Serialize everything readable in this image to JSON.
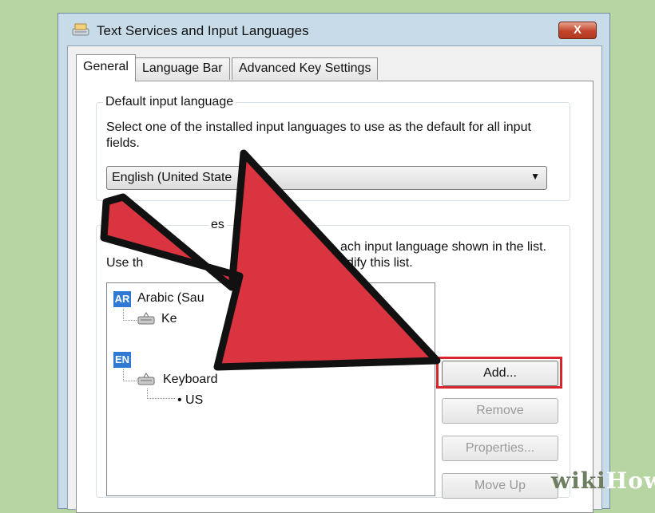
{
  "window": {
    "title": "Text Services and Input Languages",
    "close_label": "X"
  },
  "tabs": [
    {
      "label": "General",
      "active": true
    },
    {
      "label": "Language Bar",
      "active": false
    },
    {
      "label": "Advanced Key Settings",
      "active": false
    }
  ],
  "default_input": {
    "legend": "Default input language",
    "description_line1": "Select one of the installed input languages to use as the default for all input",
    "description_line2": "fields.",
    "selected": "English (United State"
  },
  "installed_services": {
    "legend_visible": "es",
    "description_line1_visible": "ach input language shown in the list.",
    "description_line2_left": "Use th",
    "description_line2_right": "dify this list.",
    "tree": {
      "lang1_code": "AR",
      "lang1_name": "Arabic (Sau",
      "lang1_child": "Ke",
      "lang2_code": "EN",
      "lang2_child": "Keyboard",
      "lang2_layout": "US"
    }
  },
  "buttons": {
    "add": "Add...",
    "remove": "Remove",
    "properties": "Properties...",
    "move_up": "Move Up"
  },
  "watermark": {
    "part1": "wiki",
    "part2": "How"
  },
  "colors": {
    "arrow_fill": "#d9343f",
    "highlight": "#d9262e",
    "background": "#b7d4a3"
  }
}
